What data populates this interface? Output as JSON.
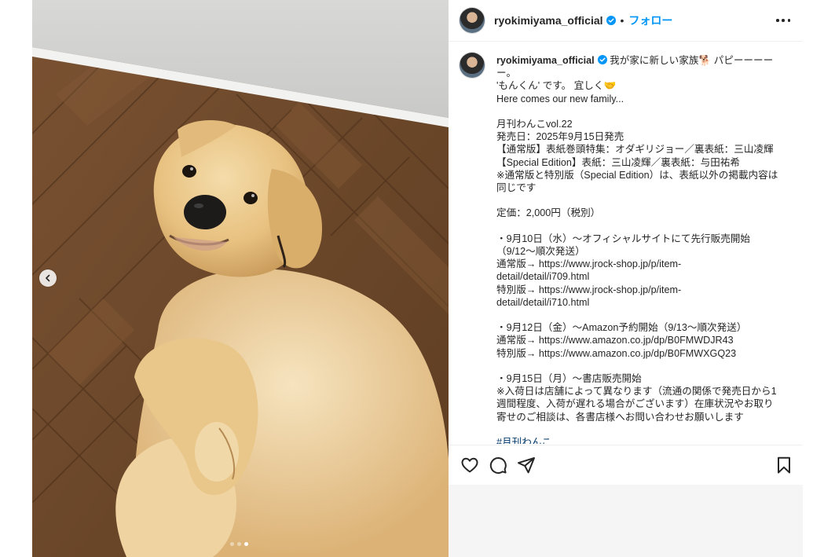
{
  "post": {
    "username": "ryokimiyama_official",
    "separator": "•",
    "follow_label": "フォロー",
    "verified_color": "#0095f6",
    "caption_lines": [
      "我が家に新しい家族🐕 パピーーーー",
      "ー。",
      "'もんくん' です。 宜しく🤝",
      "Here comes our new family...",
      "",
      "月刊わんこvol.22",
      "発売日：2025年9月15日発売",
      "【通常版】表紙巻頭特集：オダギリジョー／裏表紙：三山凌輝",
      "【Special Edition】表紙：三山凌輝／裏表紙：与田祐希",
      "※通常版と特別版（Special Edition）は、表紙以外の掲載内容は",
      "同じです",
      "",
      "定価：2,000円（税別）",
      "",
      "・9月10日（水）～オフィシャルサイトにて先行販売開始",
      "（9/12～順次発送）",
      "通常版→ https://www.jrock-shop.jp/p/item-",
      "detail/detail/i709.html",
      "特別版→ https://www.jrock-shop.jp/p/item-",
      "detail/detail/i710.html",
      "",
      "・9月12日（金）～Amazon予約開始（9/13～順次発送）",
      "通常版→ https://www.amazon.co.jp/dp/B0FMWDJR43",
      "特別版→ https://www.amazon.co.jp/dp/B0FMWXGQ23",
      "",
      "・9月15日（月）～書店販売開始",
      "※入荷日は店舗によって異なります（流通の関係で発売日から1",
      "週間程度、入荷が遅れる場合がございます）在庫状況やお取り",
      "寄せのご相談は、各書店様へお問い合わせお願いします",
      "",
      "#月刊わんこ"
    ]
  },
  "carousel": {
    "slide_count": 3,
    "active_slide": 3
  },
  "icons": {
    "prev": "chevron-left-icon",
    "more": "more-horizontal-icon",
    "like": "heart-icon",
    "comment": "comment-icon",
    "share": "paper-plane-icon",
    "save": "bookmark-icon"
  },
  "colors": {
    "link": "#0095f6",
    "hashtag": "#00376b",
    "text": "#262626"
  }
}
